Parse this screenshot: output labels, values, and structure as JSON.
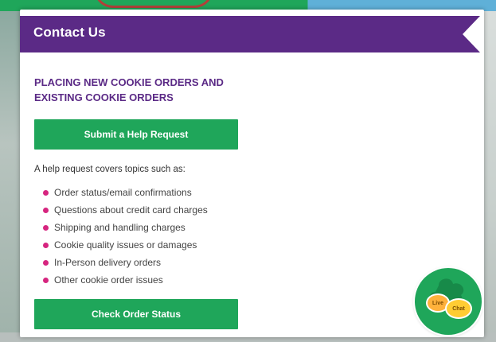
{
  "modal": {
    "title": "Contact Us",
    "section_heading": "PLACING NEW COOKIE ORDERS AND EXISTING COOKIE ORDERS",
    "help_button_label": "Submit a Help Request",
    "intro_text": "A help request covers topics such as:",
    "topics": [
      "Order status/email confirmations",
      "Questions about credit card charges",
      "Shipping and handling charges",
      "Cookie quality issues or damages",
      "In-Person delivery orders",
      "Other cookie order issues"
    ],
    "status_button_label": "Check Order Status"
  },
  "chat": {
    "live_label": "Live",
    "chat_label": "Chat"
  },
  "colors": {
    "header_purple": "#5b2a86",
    "button_green": "#1fa65a",
    "bullet_pink": "#d6257f",
    "bubble_orange": "#ffb13b",
    "bubble_yellow": "#ffcc33"
  }
}
